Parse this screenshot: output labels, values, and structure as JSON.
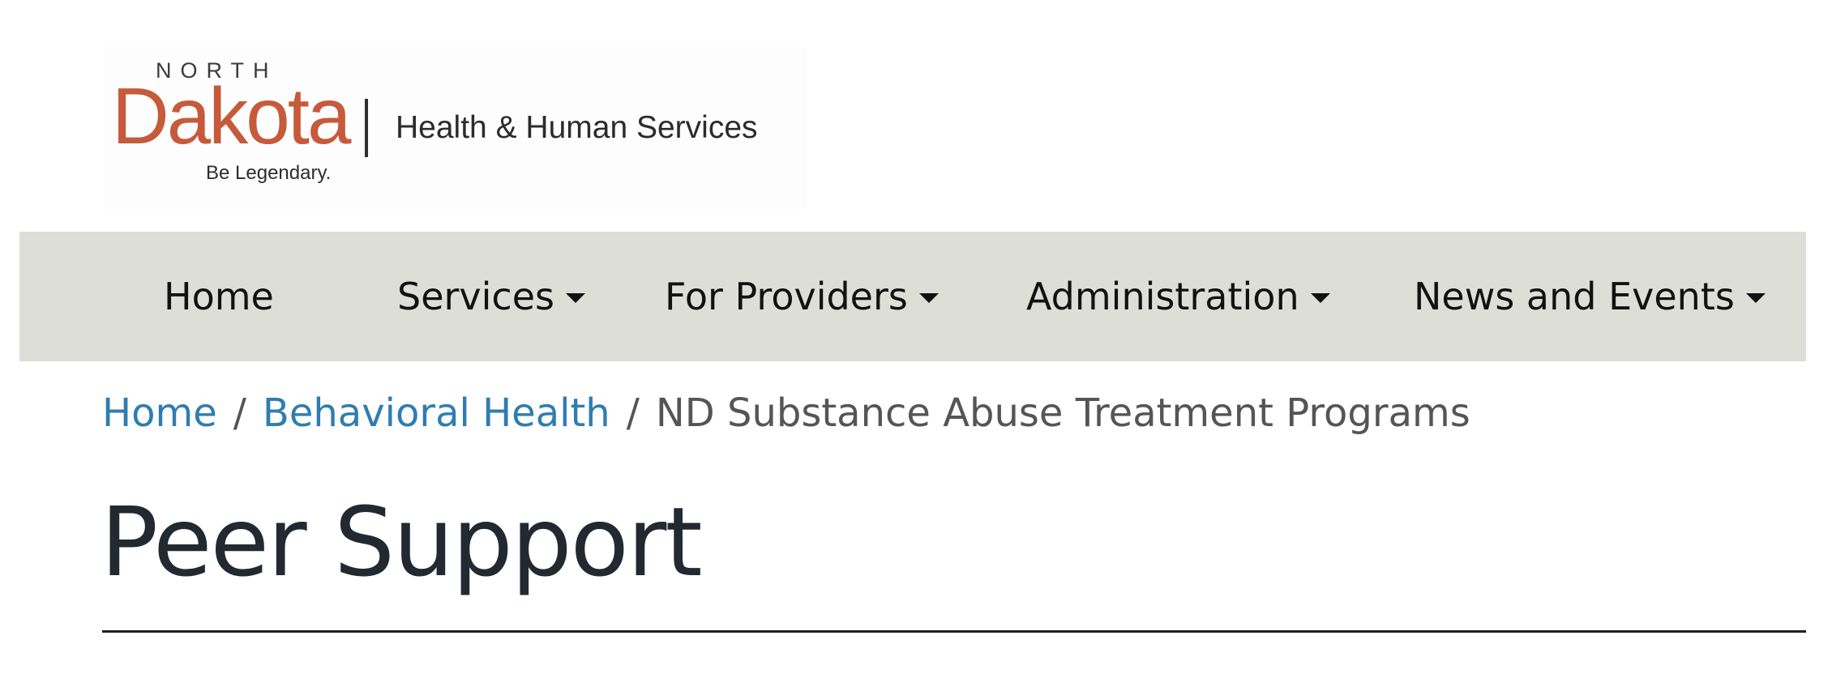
{
  "logo": {
    "north": "NORTH",
    "dakota": "Dakota",
    "tagline": "Be Legendary.",
    "org": "Health & Human Services"
  },
  "nav": {
    "items": [
      {
        "label": "Home",
        "dropdown": false
      },
      {
        "label": "Services",
        "dropdown": true
      },
      {
        "label": "For Providers",
        "dropdown": true
      },
      {
        "label": "Administration",
        "dropdown": true
      },
      {
        "label": "News and Events",
        "dropdown": true
      }
    ]
  },
  "breadcrumb": {
    "items": [
      {
        "label": "Home",
        "link": true
      },
      {
        "label": "Behavioral Health",
        "link": true
      },
      {
        "label": "ND Substance Abuse Treatment Programs",
        "link": false
      }
    ],
    "separator": "/"
  },
  "page": {
    "title": "Peer Support"
  },
  "colors": {
    "brand": "#c65a3a",
    "nav_bg": "#deded8",
    "link": "#2f7db0",
    "title": "#232931"
  }
}
